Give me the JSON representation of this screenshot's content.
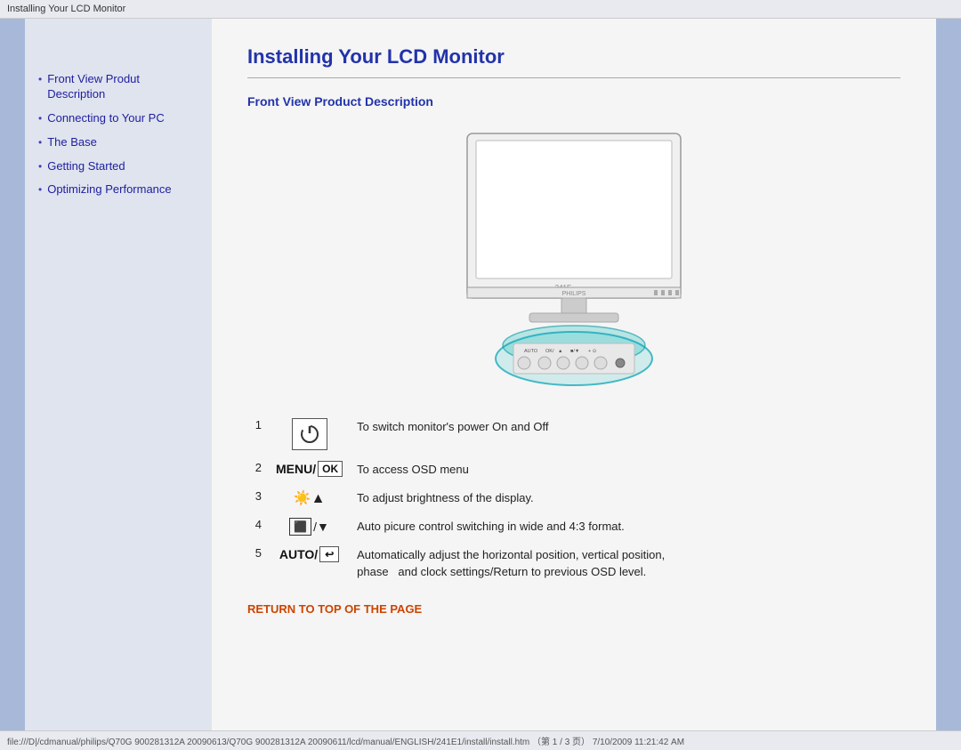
{
  "titlebar": {
    "text": "Installing Your LCD Monitor"
  },
  "sidebar": {
    "items": [
      {
        "label": "Front View Produt Description",
        "id": "front-view"
      },
      {
        "label": "Connecting to Your PC",
        "id": "connecting"
      },
      {
        "label": "The Base",
        "id": "base"
      },
      {
        "label": "Getting Started",
        "id": "getting-started"
      },
      {
        "label": "Optimizing Performance",
        "id": "optimizing"
      }
    ]
  },
  "content": {
    "page_title": "Installing Your LCD Monitor",
    "section_heading": "Front View Product Description",
    "controls": [
      {
        "num": "1",
        "icon_type": "power",
        "description": "To switch monitor's power On and Off"
      },
      {
        "num": "2",
        "icon_type": "menu_ok",
        "description": "To access OSD menu"
      },
      {
        "num": "3",
        "icon_type": "brightness",
        "description": "To adjust brightness of the display."
      },
      {
        "num": "4",
        "icon_type": "wide",
        "description": "Auto picure control switching in wide and 4:3 format."
      },
      {
        "num": "5",
        "icon_type": "auto",
        "description_line1": "Automatically adjust the horizontal position, vertical position,",
        "description_line2": "phase   and clock settings/Return to previous OSD level."
      }
    ],
    "return_label": "RETURN TO TOP OF THE PAGE"
  },
  "bottombar": {
    "text": "file:///D|/cdmanual/philips/Q70G 900281312A 20090613/Q70G 900281312A 20090611/lcd/manual/ENGLISH/241E1/install/install.htm  （第 1 / 3 页） 7/10/2009 11:21:42 AM"
  }
}
